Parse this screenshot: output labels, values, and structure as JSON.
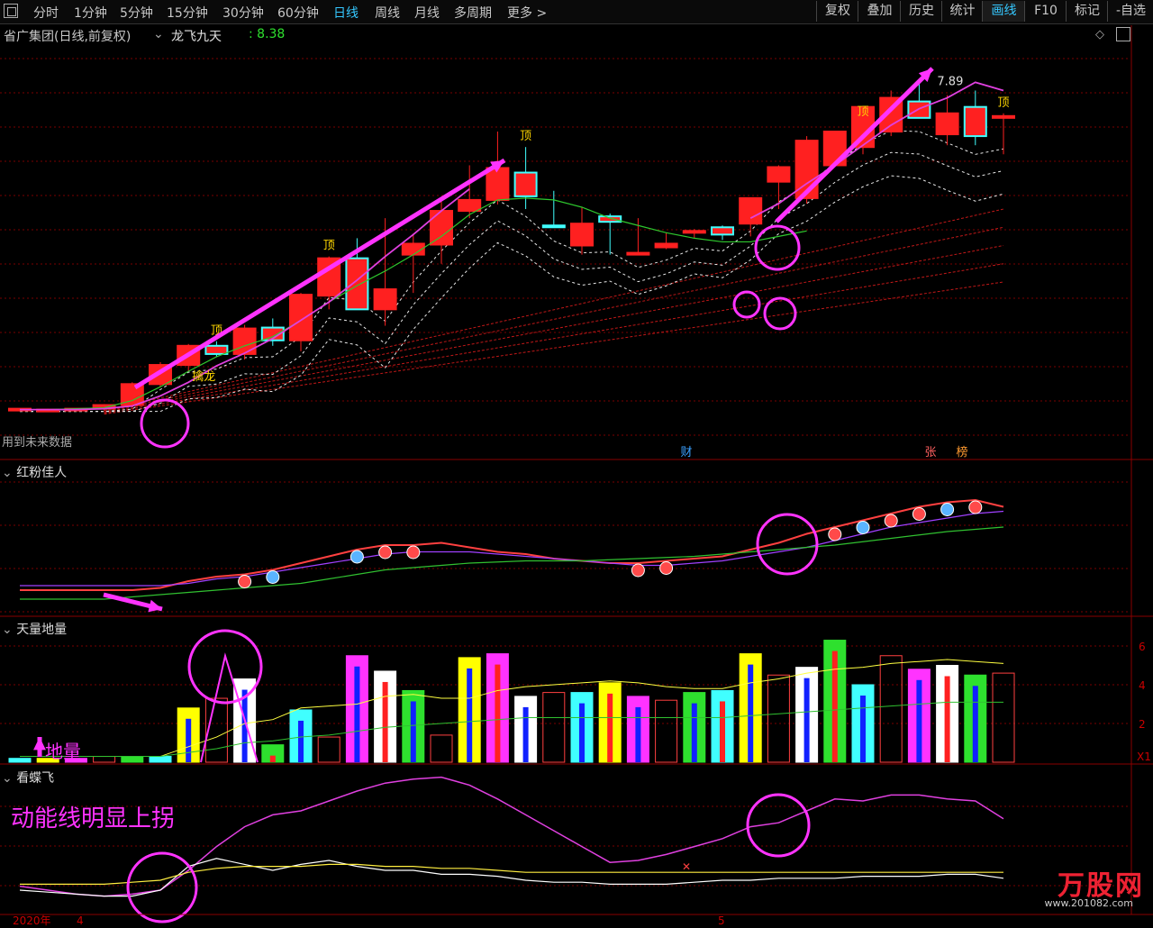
{
  "toolbar": {
    "left_items": [
      "分时",
      "1分钟",
      "5分钟",
      "15分钟",
      "30分钟",
      "60分钟",
      "日线",
      "周线",
      "月线",
      "多周期",
      "更多 >"
    ],
    "active_left": "日线",
    "right_items": [
      "复权",
      "叠加",
      "历史",
      "统计",
      "画线",
      "F10",
      "标记",
      "-自选"
    ],
    "active_right": "画线"
  },
  "main_panel": {
    "stock": "省广集团(日线,前复权)",
    "indicator": "龙飞九天",
    "indicator_value": ": 8.38",
    "bottom_left_text": "用到未来数据",
    "marker_labels": [
      "财",
      "张",
      "榜"
    ]
  },
  "panels": {
    "hongfen": "红粉佳人",
    "tianliang": "天量地量",
    "kandiefei": "看蝶飞"
  },
  "annotations": {
    "diliang": "地量",
    "dongneng": "动能线明显上拐",
    "ding": "顶",
    "qinlong": "擒龙",
    "high_price": "7.89"
  },
  "axis": {
    "year_label": "2020年",
    "month_labels": [
      "4",
      "5"
    ],
    "vol_ticks": [
      "6",
      "4",
      "2"
    ],
    "vol_unit": "X1"
  },
  "watermark": {
    "text": "万股网",
    "url": "www.201082.com"
  },
  "colors": {
    "up": "#ff2020",
    "down": "#40ffff",
    "ma_green": "#2ec82e",
    "ma_pink": "#e040e0",
    "annot": "#ff33ff",
    "grid": "#7a0000",
    "ding": "#ffd700"
  },
  "chart_data": [
    {
      "type": "candlestick",
      "title": "省广集团(日线,前复权)",
      "indicator": "龙飞九天",
      "x": [
        "d1",
        "d2",
        "d3",
        "d4",
        "d5",
        "d6",
        "d7",
        "d8",
        "d9",
        "d10",
        "d11",
        "d12",
        "d13",
        "d14",
        "d15",
        "d16",
        "d17",
        "d18",
        "d19",
        "d20",
        "d21",
        "d22",
        "d23",
        "d24",
        "d25",
        "d26",
        "d27",
        "d28",
        "d29",
        "d30",
        "d31",
        "d32",
        "d33",
        "d34",
        "d35",
        "d36"
      ],
      "open": [
        4.3,
        4.3,
        4.3,
        4.31,
        4.35,
        4.58,
        4.79,
        5.0,
        4.91,
        5.2,
        5.06,
        5.55,
        5.96,
        5.4,
        6.0,
        6.11,
        6.48,
        6.6,
        6.9,
        6.32,
        6.1,
        6.42,
        6.0,
        6.08,
        6.24,
        6.3,
        6.34,
        6.8,
        6.62,
        6.98,
        7.18,
        7.35,
        7.68,
        7.32,
        7.62,
        7.5
      ],
      "high": [
        4.31,
        4.31,
        4.31,
        4.36,
        4.6,
        4.82,
        5.02,
        5.05,
        5.23,
        5.3,
        5.58,
        5.98,
        6.18,
        6.4,
        6.23,
        6.6,
        6.98,
        7.35,
        7.18,
        6.7,
        6.52,
        6.45,
        6.4,
        6.24,
        6.28,
        6.32,
        6.6,
        6.98,
        7.3,
        7.35,
        7.45,
        7.8,
        7.89,
        7.75,
        7.8,
        7.55
      ],
      "low": [
        4.28,
        4.28,
        4.28,
        4.29,
        4.33,
        4.55,
        4.72,
        4.88,
        4.85,
        5.0,
        4.94,
        5.4,
        5.9,
        5.22,
        5.58,
        5.9,
        6.4,
        6.55,
        6.5,
        6.3,
        6.0,
        6.0,
        6.0,
        6.06,
        6.18,
        6.16,
        6.2,
        6.5,
        6.56,
        6.96,
        7.1,
        7.3,
        7.5,
        7.2,
        7.2,
        7.1
      ],
      "close": [
        4.31,
        4.3,
        4.31,
        4.35,
        4.58,
        4.79,
        5.0,
        4.91,
        5.19,
        5.06,
        5.56,
        5.96,
        5.4,
        5.62,
        6.12,
        6.48,
        6.6,
        6.95,
        6.64,
        6.3,
        6.34,
        6.36,
        6.02,
        6.12,
        6.26,
        6.22,
        6.62,
        6.96,
        7.25,
        7.35,
        7.62,
        7.72,
        7.5,
        7.55,
        7.3,
        7.52
      ],
      "ma_green": {
        "name": "",
        "values": [
          4.3,
          4.3,
          4.31,
          4.32,
          4.4,
          4.55,
          4.72,
          4.88,
          5.0,
          5.1,
          5.28,
          5.48,
          5.66,
          5.82,
          6.0,
          6.2,
          6.44,
          6.6,
          6.62,
          6.6,
          6.52,
          6.4,
          6.32,
          6.24,
          6.18,
          6.14,
          6.14,
          6.2,
          6.26,
          null,
          null,
          null,
          null,
          null,
          null,
          null
        ]
      },
      "ma_pink": {
        "name": "",
        "values": [
          4.3,
          4.3,
          4.3,
          4.31,
          4.34,
          4.45,
          4.6,
          4.78,
          4.92,
          5.08,
          5.28,
          5.48,
          5.72,
          5.98,
          6.22,
          6.48,
          6.72,
          null,
          null,
          null,
          null,
          null,
          null,
          null,
          null,
          null,
          6.4,
          6.56,
          6.78,
          6.98,
          7.2,
          7.42,
          7.6,
          7.72,
          7.89,
          7.8
        ]
      },
      "labels": {
        "ding": "顶",
        "qinlong": "擒龙",
        "high_value": "7.89"
      }
    },
    {
      "type": "line",
      "title": "红粉佳人",
      "series": [
        {
          "name": "",
          "values": [
            1.0,
            1.0,
            1.0,
            1.0,
            1.0,
            1.1,
            1.4,
            1.6,
            1.7,
            1.9,
            2.2,
            2.5,
            2.8,
            3.0,
            3.0,
            3.1,
            2.9,
            2.7,
            2.6,
            2.4,
            2.3,
            2.2,
            2.2,
            2.3,
            2.4,
            2.5,
            2.8,
            3.1,
            3.5,
            3.8,
            4.1,
            4.4,
            4.7,
            4.9,
            5.0,
            4.7
          ]
        },
        {
          "name": "",
          "values": [
            1.2,
            1.2,
            1.2,
            1.2,
            1.2,
            1.2,
            1.3,
            1.5,
            1.6,
            1.8,
            2.0,
            2.2,
            2.4,
            2.6,
            2.7,
            2.7,
            2.7,
            2.6,
            2.5,
            2.4,
            2.3,
            2.2,
            2.1,
            2.1,
            2.2,
            2.3,
            2.5,
            2.7,
            2.9,
            3.2,
            3.5,
            3.8,
            4.0,
            4.2,
            4.4,
            4.5
          ]
        },
        {
          "name": "",
          "values": [
            0.6,
            0.6,
            0.6,
            0.6,
            0.7,
            0.8,
            0.9,
            1.0,
            1.1,
            1.2,
            1.3,
            1.5,
            1.7,
            1.9,
            2.0,
            2.1,
            2.2,
            2.25,
            2.3,
            2.3,
            2.3,
            2.35,
            2.4,
            2.45,
            2.5,
            2.6,
            2.7,
            2.8,
            2.9,
            3.0,
            3.15,
            3.3,
            3.45,
            3.6,
            3.7,
            3.8
          ]
        }
      ]
    },
    {
      "type": "bar",
      "title": "天量地量",
      "yticks": [
        2,
        4,
        6
      ],
      "volumes": [
        0.2,
        0.2,
        0.2,
        0.3,
        0.3,
        0.3,
        2.8,
        3.3,
        4.3,
        0.9,
        2.7,
        1.3,
        5.5,
        4.7,
        3.7,
        1.4,
        5.4,
        5.6,
        3.4,
        3.6,
        3.6,
        4.1,
        3.4,
        3.2,
        3.6,
        3.7,
        5.6,
        4.5,
        4.9,
        6.3,
        4.0,
        5.5,
        4.8,
        5.0,
        4.5,
        4.6
      ],
      "ma5": [
        0.3,
        0.3,
        0.3,
        0.3,
        0.3,
        0.3,
        0.8,
        1.3,
        2.0,
        2.2,
        2.8,
        2.9,
        3.0,
        3.4,
        3.5,
        3.3,
        3.3,
        3.7,
        3.9,
        4.0,
        4.1,
        4.2,
        4.1,
        3.9,
        3.8,
        3.8,
        4.1,
        4.3,
        4.6,
        4.8,
        4.9,
        5.1,
        5.2,
        5.3,
        5.2,
        5.1
      ],
      "ma10": [
        0.3,
        0.3,
        0.3,
        0.3,
        0.3,
        0.3,
        0.5,
        0.7,
        1.0,
        1.1,
        1.3,
        1.4,
        1.6,
        1.8,
        1.9,
        2.0,
        2.1,
        2.2,
        2.3,
        2.3,
        2.3,
        2.3,
        2.3,
        2.3,
        2.3,
        2.3,
        2.4,
        2.5,
        2.6,
        2.7,
        2.8,
        2.9,
        3.0,
        3.1,
        3.1,
        3.1
      ]
    },
    {
      "type": "line",
      "title": "看蝶飞",
      "series": [
        {
          "name": "",
          "values": [
            1.2,
            1.0,
            0.8,
            0.7,
            0.8,
            1.0,
            2.0,
            3.2,
            4.2,
            4.8,
            5.0,
            5.5,
            6.0,
            6.4,
            6.6,
            6.7,
            6.3,
            5.6,
            4.8,
            4.0,
            3.2,
            2.4,
            2.5,
            2.8,
            3.2,
            3.6,
            4.2,
            4.4,
            5.0,
            5.6,
            5.5,
            5.8,
            5.8,
            5.6,
            5.5,
            4.6
          ]
        },
        {
          "name": "",
          "values": [
            1.0,
            0.9,
            0.8,
            0.7,
            0.7,
            1.0,
            2.2,
            2.6,
            2.3,
            2.0,
            2.3,
            2.5,
            2.2,
            2.0,
            2.0,
            1.8,
            1.8,
            1.7,
            1.5,
            1.4,
            1.4,
            1.3,
            1.3,
            1.3,
            1.4,
            1.5,
            1.5,
            1.6,
            1.6,
            1.6,
            1.7,
            1.7,
            1.7,
            1.8,
            1.8,
            1.6
          ]
        },
        {
          "name": "",
          "values": [
            1.3,
            1.3,
            1.3,
            1.3,
            1.4,
            1.5,
            1.9,
            2.1,
            2.2,
            2.2,
            2.2,
            2.3,
            2.3,
            2.2,
            2.2,
            2.1,
            2.1,
            2.0,
            1.9,
            1.9,
            1.9,
            1.9,
            1.9,
            1.9,
            1.9,
            1.9,
            1.9,
            1.9,
            1.9,
            1.9,
            1.9,
            1.9,
            1.9,
            1.9,
            1.9,
            1.9
          ]
        }
      ]
    }
  ]
}
